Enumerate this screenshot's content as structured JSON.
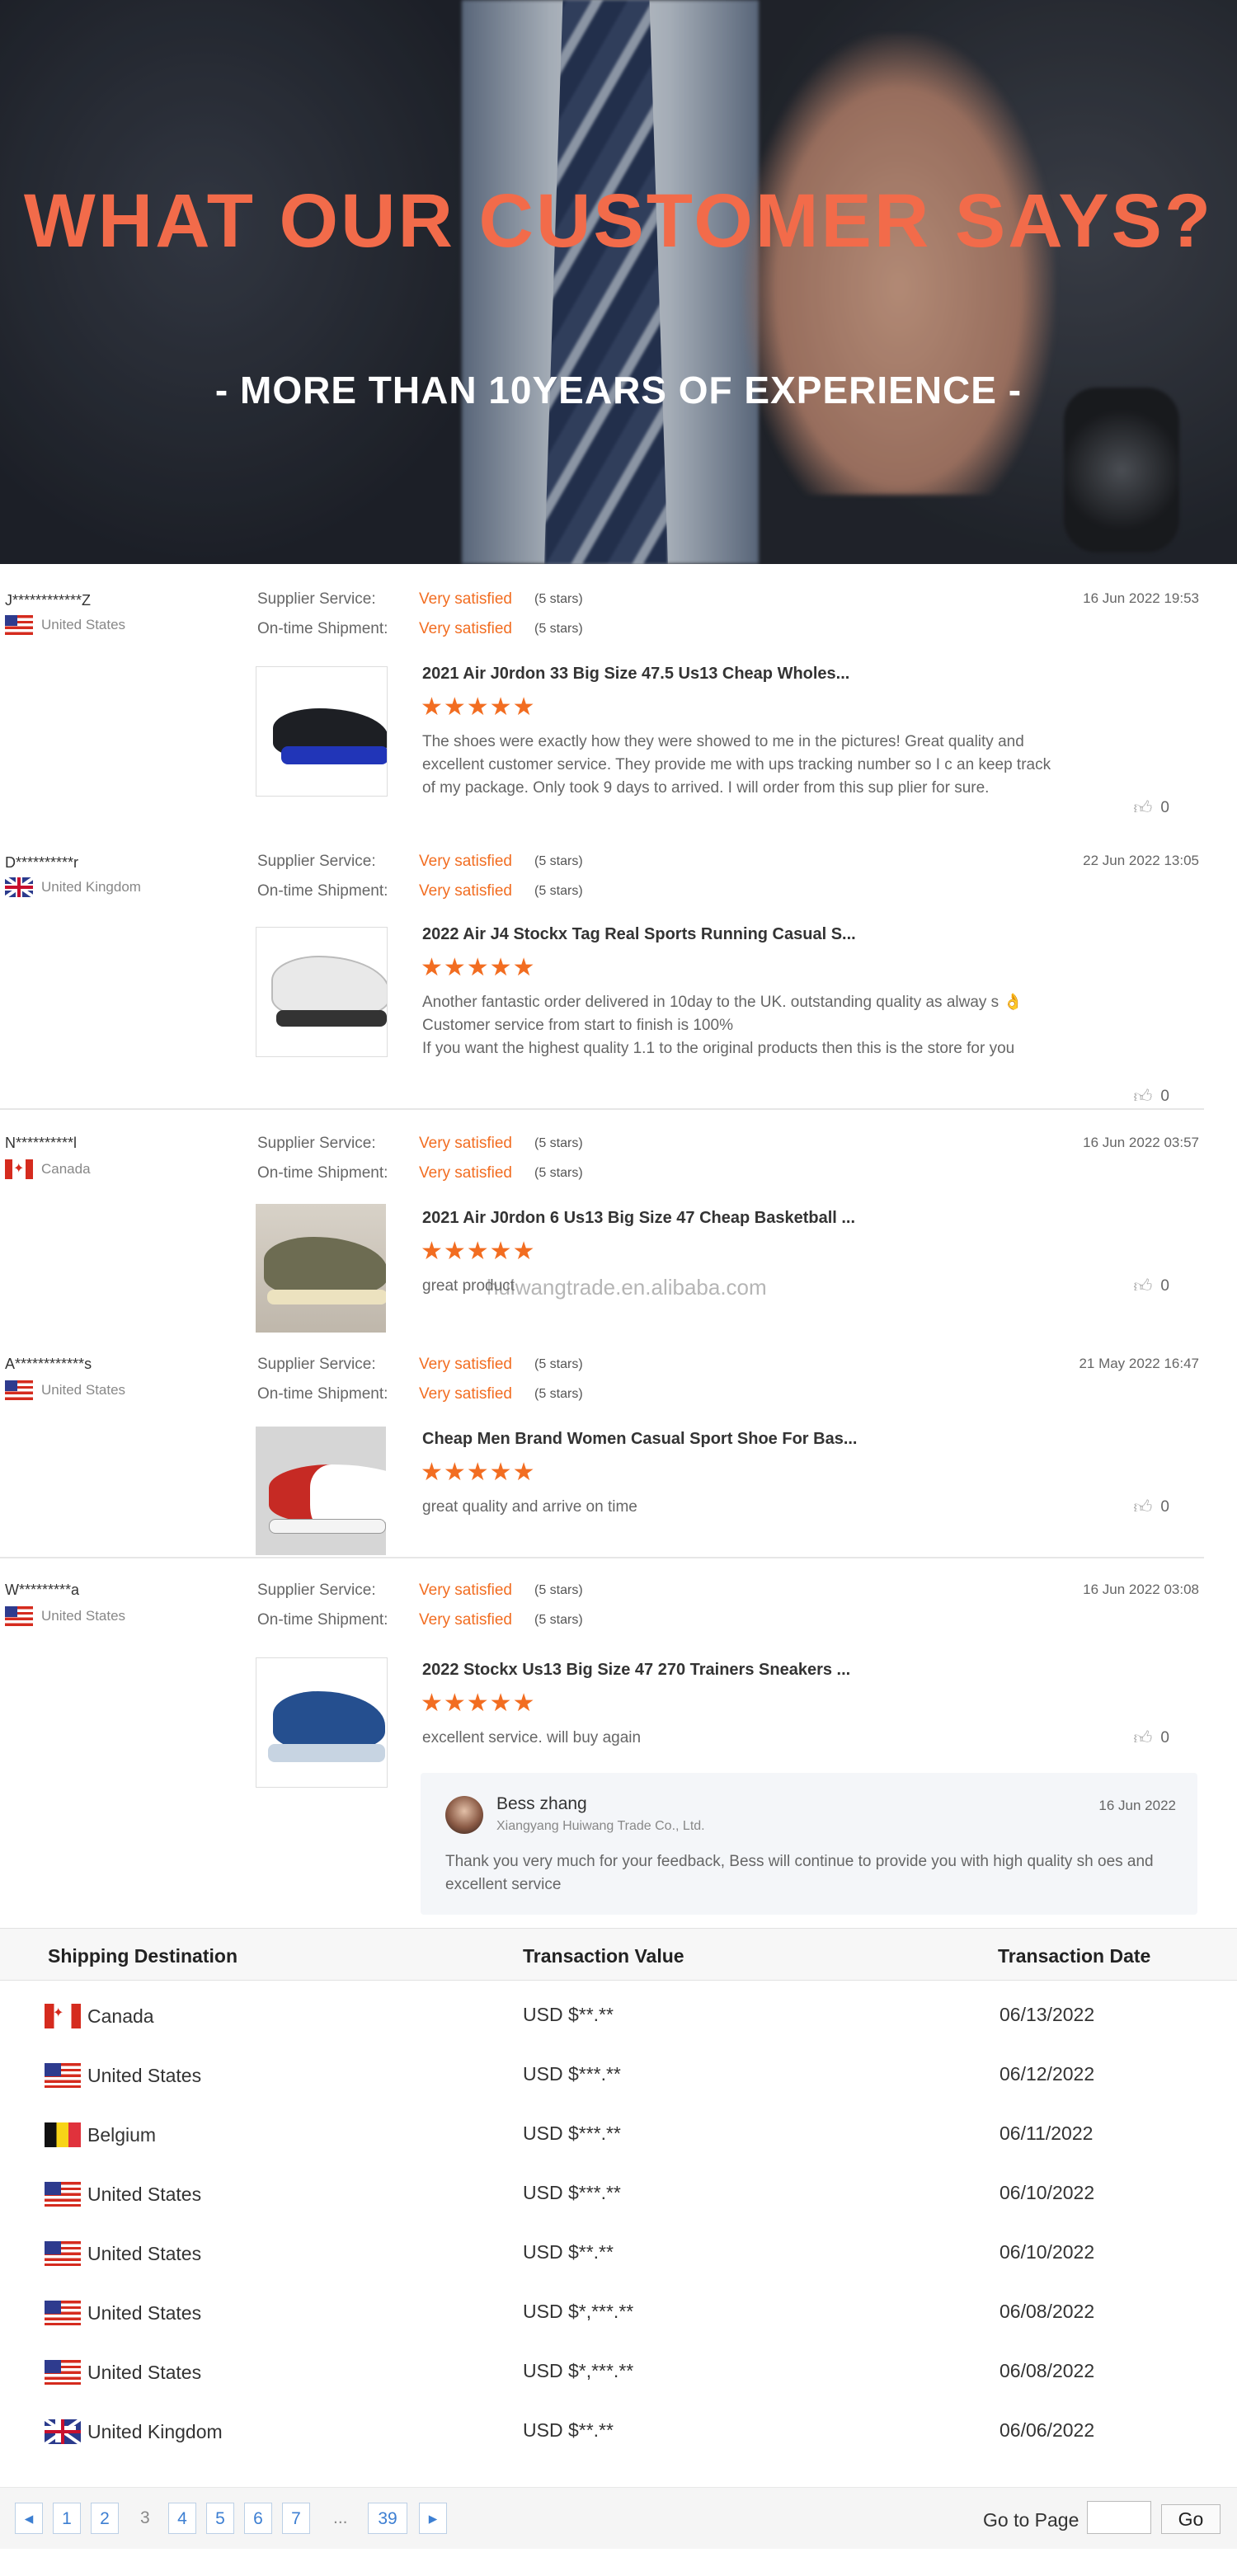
{
  "hero": {
    "title": "WHAT OUR CUSTOMER SAYS?",
    "subtitle": "- MORE THAN 10YEARS OF EXPERIENCE -"
  },
  "labels": {
    "supplier_service": "Supplier Service:",
    "ontime_shipment": "On-time Shipment:",
    "very_satisfied": "Very satisfied",
    "five_stars": "(5 stars)",
    "star_glyphs": "★★★★★"
  },
  "reviews": [
    {
      "user": "J************Z",
      "country": "United States",
      "flag": "us",
      "date": "16 Jun 2022 19:53",
      "product_title": "2021 Air J0rdon 33 Big Size 47.5 Us13 Cheap Wholes...",
      "text": "The shoes were exactly how they were showed to me in the pictures! Great quality and excellent customer service. They provide me with ups tracking number so I c an keep track of my package. Only took 9 days to arrived. I will order from this sup plier for sure.",
      "likes": "0"
    },
    {
      "user": "D**********r",
      "country": "United Kingdom",
      "flag": "uk",
      "date": "22 Jun 2022 13:05",
      "product_title": "2022 Air J4 Stockx Tag Real Sports Running Casual S...",
      "text": "Another fantastic order delivered in 10day to the UK. outstanding quality as alway s 👌\nCustomer service from start to finish is 100%\nIf you want the highest quality 1.1 to the original products then this is the store for you",
      "likes": "0"
    },
    {
      "user": "N**********l",
      "country": "Canada",
      "flag": "ca",
      "date": "16 Jun 2022 03:57",
      "product_title": "2021 Air J0rdon 6 Us13 Big Size 47 Cheap Basketball ...",
      "text": "great product",
      "likes": "0"
    },
    {
      "user": "A************s",
      "country": "United States",
      "flag": "us",
      "date": "21 May 2022 16:47",
      "product_title": "Cheap Men Brand Women Casual Sport Shoe For Bas...",
      "text": "great quality and arrive on time",
      "likes": "0"
    },
    {
      "user": "W*********a",
      "country": "United States",
      "flag": "us",
      "date": "16 Jun 2022 03:08",
      "product_title": "2022 Stockx Us13 Big Size 47 270 Trainers Sneakers ...",
      "text": "excellent service. will buy again",
      "likes": "0"
    }
  ],
  "watermark": "huiwangtrade.en.alibaba.com",
  "reply": {
    "name": "Bess zhang",
    "company": "Xiangyang Huiwang Trade Co., Ltd.",
    "date": "16 Jun 2022",
    "text": "Thank you very much for your feedback, Bess will continue to provide you with high quality sh oes and excellent service"
  },
  "table": {
    "headers": [
      "Shipping Destination",
      "Transaction Value",
      "Transaction Date"
    ],
    "rows": [
      {
        "country": "Canada",
        "flag": "ca",
        "value": "USD $**.**",
        "date": "06/13/2022"
      },
      {
        "country": "United States",
        "flag": "us",
        "value": "USD $***.**",
        "date": "06/12/2022"
      },
      {
        "country": "Belgium",
        "flag": "be",
        "value": "USD $***.**",
        "date": "06/11/2022"
      },
      {
        "country": "United States",
        "flag": "us",
        "value": "USD $***.**",
        "date": "06/10/2022"
      },
      {
        "country": "United States",
        "flag": "us",
        "value": "USD $**.**",
        "date": "06/10/2022"
      },
      {
        "country": "United States",
        "flag": "us",
        "value": "USD $*,***.**",
        "date": "06/08/2022"
      },
      {
        "country": "United States",
        "flag": "us",
        "value": "USD $*,***.**",
        "date": "06/08/2022"
      },
      {
        "country": "United Kingdom",
        "flag": "uk",
        "value": "USD $**.**",
        "date": "06/06/2022"
      }
    ]
  },
  "pagination": {
    "prev": "◂",
    "pages": [
      "1",
      "2",
      "3",
      "4",
      "5",
      "6",
      "7"
    ],
    "current": "3",
    "ellipsis": "...",
    "last": "39",
    "next": "▸",
    "goto_label": "Go to Page",
    "go_button": "Go"
  }
}
